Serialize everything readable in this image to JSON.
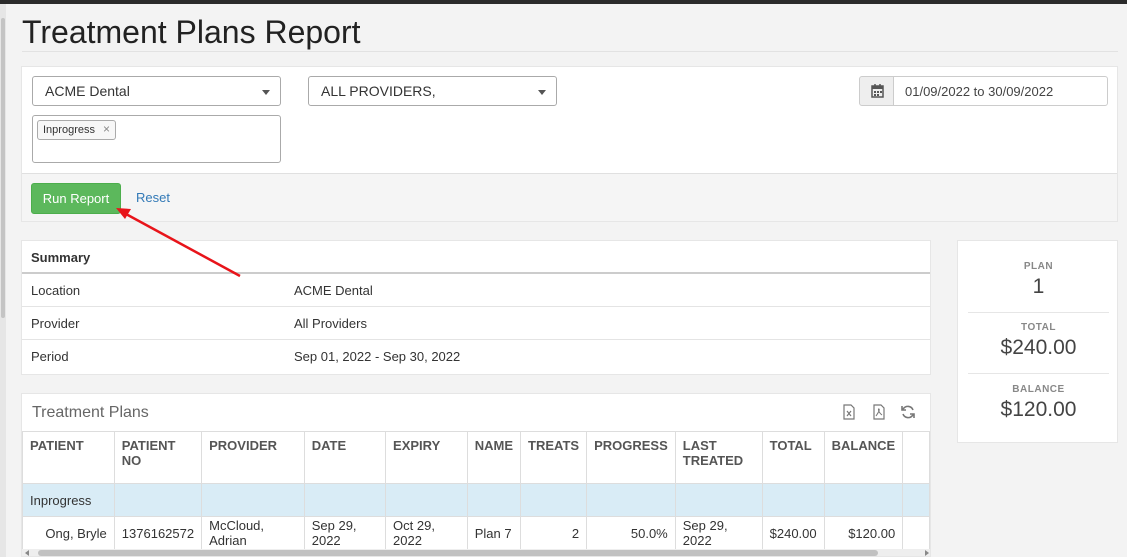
{
  "page": {
    "title": "Treatment Plans Report"
  },
  "filters": {
    "location_value": "ACME Dental",
    "provider_value": "ALL PROVIDERS,",
    "status_tags": [
      "Inprogress"
    ],
    "date_range": "01/09/2022 to 30/09/2022",
    "run_label": "Run Report",
    "reset_label": "Reset"
  },
  "summary": {
    "header": "Summary",
    "rows": [
      {
        "label": "Location",
        "value": "ACME Dental"
      },
      {
        "label": "Provider",
        "value": "All Providers"
      },
      {
        "label": "Period",
        "value": "Sep 01, 2022 - Sep 30, 2022"
      }
    ]
  },
  "stats": {
    "plan_label": "PLAN",
    "plan_value": "1",
    "total_label": "TOTAL",
    "total_value": "$240.00",
    "balance_label": "BALANCE",
    "balance_value": "$120.00"
  },
  "treatment_plans": {
    "title": "Treatment Plans",
    "columns": [
      "PATIENT",
      "PATIENT NO",
      "PROVIDER",
      "DATE",
      "EXPIRY",
      "NAME",
      "TREATS",
      "PROGRESS",
      "LAST TREATED",
      "TOTAL",
      "BALANCE"
    ],
    "group_label": "Inprogress",
    "rows": [
      {
        "patient": "Ong, Bryle",
        "patient_no": "1376162572",
        "provider": "McCloud, Adrian",
        "date": "Sep 29, 2022",
        "expiry": "Oct 29, 2022",
        "name": "Plan 7",
        "treats": "2",
        "progress": "50.0%",
        "last_treated": "Sep 29, 2022",
        "total": "$240.00",
        "balance": "$120.00"
      }
    ]
  },
  "colors": {
    "run_button": "#5cb85c",
    "link": "#337ab7",
    "group_row": "#d9ecf6",
    "annotation_arrow": "#e8141a"
  },
  "icons": [
    "calendar-icon",
    "excel-export-icon",
    "pdf-export-icon",
    "refresh-icon"
  ]
}
